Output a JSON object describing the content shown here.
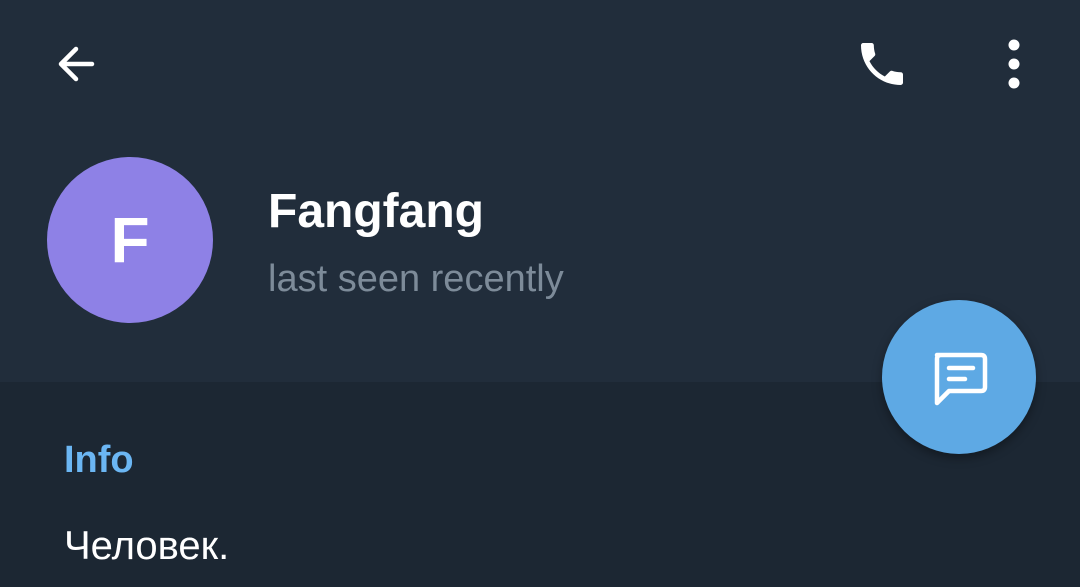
{
  "colors": {
    "header_bg": "#212d3b",
    "body_bg": "#1c2733",
    "avatar_bg": "#8e81e6",
    "fab_bg": "#5ea9e4",
    "accent_text": "#6bb6f3"
  },
  "toolbar": {
    "back_icon": "arrow-left-icon",
    "call_icon": "phone-icon",
    "more_icon": "more-vertical-icon"
  },
  "profile": {
    "avatar_letter": "F",
    "name": "Fangfang",
    "status": "last seen recently"
  },
  "fab": {
    "icon": "message-icon"
  },
  "info": {
    "section_title": "Info",
    "bio": "Человек."
  }
}
